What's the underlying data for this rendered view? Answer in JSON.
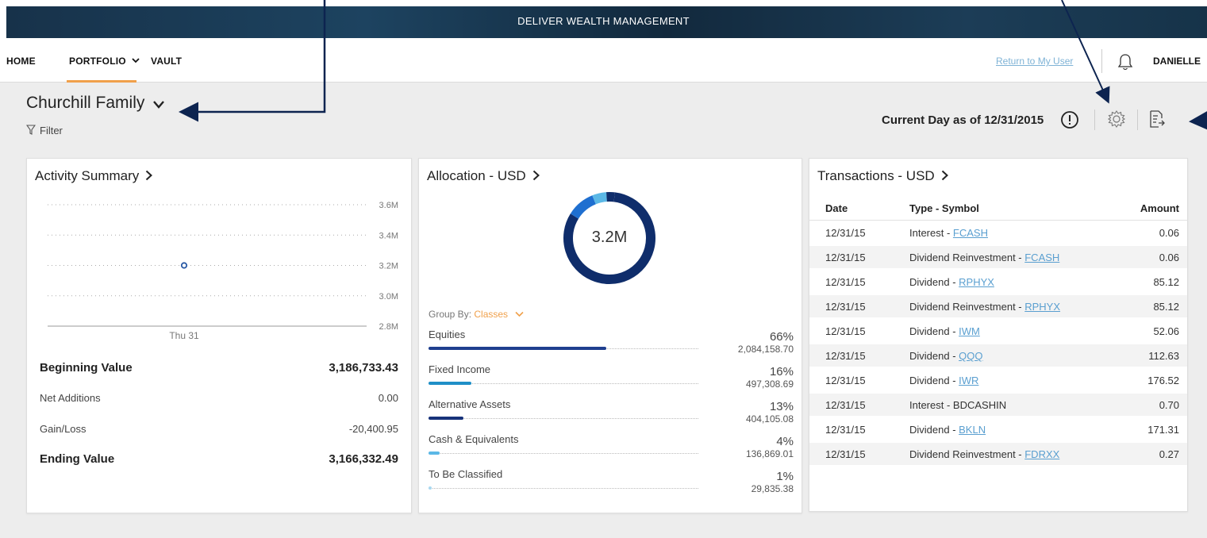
{
  "app": {
    "banner_title": "DELIVER WEALTH MANAGEMENT"
  },
  "nav": {
    "items": [
      "HOME",
      "PORTFOLIO",
      "VAULT"
    ],
    "return_link": "Return to My User",
    "user": "DANIELLE"
  },
  "header": {
    "title": "Churchill Family",
    "filter_label": "Filter",
    "as_of": "Current Day as of 12/31/2015"
  },
  "activity": {
    "title": "Activity Summary",
    "chart_data": {
      "type": "scatter",
      "x": [
        "Thu 31"
      ],
      "y": [
        3.2
      ],
      "ylim": [
        2.8,
        3.6
      ],
      "y_ticks": [
        "3.6M",
        "3.4M",
        "3.2M",
        "3.0M",
        "2.8M"
      ],
      "x_ticks": [
        "Thu 31"
      ],
      "grid": true
    },
    "rows": [
      {
        "label": "Beginning Value",
        "value": "3,186,733.43"
      },
      {
        "label": "Net Additions",
        "value": "0.00"
      },
      {
        "label": "Gain/Loss",
        "value": "-20,400.95"
      },
      {
        "label": "Ending Value",
        "value": "3,166,332.49"
      }
    ]
  },
  "allocation": {
    "title": "Allocation - USD",
    "center_value": "3.2M",
    "group_by_label": "Group By:",
    "group_by_value": "Classes",
    "items": [
      {
        "name": "Equities",
        "percent": "66%",
        "amount": "2,084,158.70",
        "fraction": 0.66,
        "color": "#1f3f8f"
      },
      {
        "name": "Fixed Income",
        "percent": "16%",
        "amount": "497,308.69",
        "fraction": 0.16,
        "color": "#1f8fc7"
      },
      {
        "name": "Alternative Assets",
        "percent": "13%",
        "amount": "404,105.08",
        "fraction": 0.13,
        "color": "#17327a"
      },
      {
        "name": "Cash & Equivalents",
        "percent": "4%",
        "amount": "136,869.01",
        "fraction": 0.04,
        "color": "#5bb8e6"
      },
      {
        "name": "To Be Classified",
        "percent": "1%",
        "amount": "29,835.38",
        "fraction": 0.01,
        "color": "#a9d8f0"
      }
    ]
  },
  "transactions": {
    "title": "Transactions - USD",
    "columns": [
      "Date",
      "Type - Symbol",
      "Amount"
    ],
    "rows": [
      {
        "date": "12/31/15",
        "type": "Interest - ",
        "symbol": "FCASH",
        "amount": "0.06"
      },
      {
        "date": "12/31/15",
        "type": "Dividend Reinvestment - ",
        "symbol": "FCASH",
        "amount": "0.06"
      },
      {
        "date": "12/31/15",
        "type": "Dividend - ",
        "symbol": "RPHYX",
        "amount": "85.12"
      },
      {
        "date": "12/31/15",
        "type": "Dividend Reinvestment - ",
        "symbol": "RPHYX",
        "amount": "85.12"
      },
      {
        "date": "12/31/15",
        "type": "Dividend - ",
        "symbol": "IWM",
        "amount": "52.06"
      },
      {
        "date": "12/31/15",
        "type": "Dividend - ",
        "symbol": "QQQ",
        "amount": "112.63"
      },
      {
        "date": "12/31/15",
        "type": "Dividend - ",
        "symbol": "IWR",
        "amount": "176.52"
      },
      {
        "date": "12/31/15",
        "type": "Interest - BDCASHIN",
        "symbol": "",
        "amount": "0.70"
      },
      {
        "date": "12/31/15",
        "type": "Dividend - ",
        "symbol": "BKLN",
        "amount": "171.31"
      },
      {
        "date": "12/31/15",
        "type": "Dividend Reinvestment - ",
        "symbol": "FDRXX",
        "amount": "0.27"
      }
    ]
  },
  "colors": {
    "accent": "#f0a04b",
    "navy": "#0f2d6b",
    "link": "#5a9fd0"
  }
}
